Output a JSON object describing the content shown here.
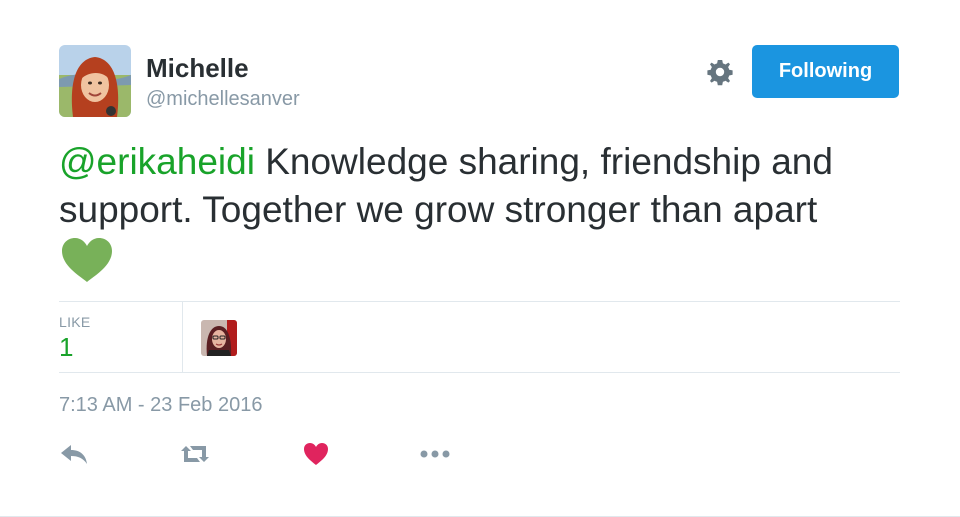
{
  "author": {
    "name": "Michelle",
    "handle": "@michellesanver"
  },
  "header": {
    "follow_label": "Following",
    "settings_icon": "gear-icon"
  },
  "tweet": {
    "mention": "@erikaheidi",
    "text": " Knowledge sharing, friendship and support. Together we grow stronger than apart",
    "emoji": "green-heart-icon"
  },
  "stats": {
    "like_label": "LIKE",
    "like_count": "1"
  },
  "timestamp": "7:13 AM - 23 Feb 2016",
  "actions": {
    "reply_icon": "reply-icon",
    "retweet_icon": "retweet-icon",
    "like_icon": "heart-icon",
    "more_icon": "more-dots-icon"
  },
  "colors": {
    "accent": "#1b95e0",
    "mention": "#19a32a",
    "like": "#e0245e",
    "muted": "#8899a6"
  }
}
